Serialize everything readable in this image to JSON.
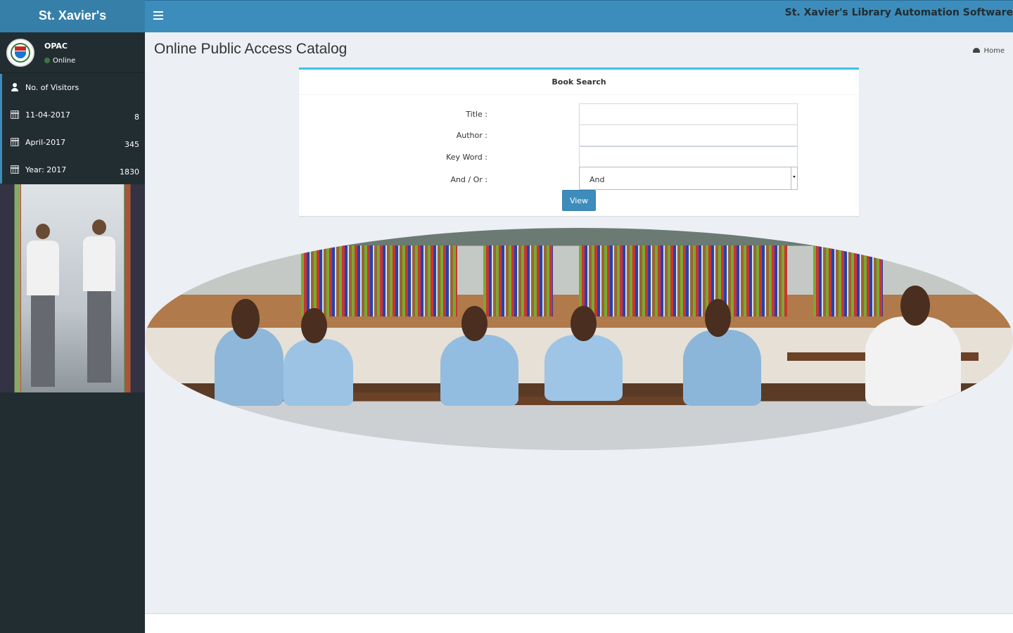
{
  "header": {
    "brand": "St. Xavier's",
    "app_title": "St. Xavier's Library Automation Software"
  },
  "sidebar": {
    "user": {
      "name": "OPAC",
      "status": "Online"
    },
    "items": [
      {
        "label": "No. of Visitors",
        "count": "",
        "icon": "user-icon"
      },
      {
        "label": "11-04-2017",
        "count": "8",
        "icon": "calendar-icon"
      },
      {
        "label": "April-2017",
        "count": "345",
        "icon": "calendar-icon"
      },
      {
        "label": "Year: 2017",
        "count": "1830",
        "icon": "calendar-icon"
      }
    ]
  },
  "main": {
    "page_title": "Online Public Access Catalog",
    "breadcrumb": "Home",
    "search_box": {
      "title": "Book Search",
      "fields": [
        {
          "label": "Title :",
          "value": ""
        },
        {
          "label": "Author :",
          "value": ""
        },
        {
          "label": "Key Word :",
          "value": ""
        }
      ],
      "and_or": {
        "label": "And / Or :",
        "selected": "And"
      },
      "button": "View"
    }
  },
  "colors": {
    "header": "#3c8dbc",
    "brand": "#367fa9",
    "sidebar": "#222d32",
    "box_top": "#3ec1e3",
    "online": "#3c763d"
  }
}
